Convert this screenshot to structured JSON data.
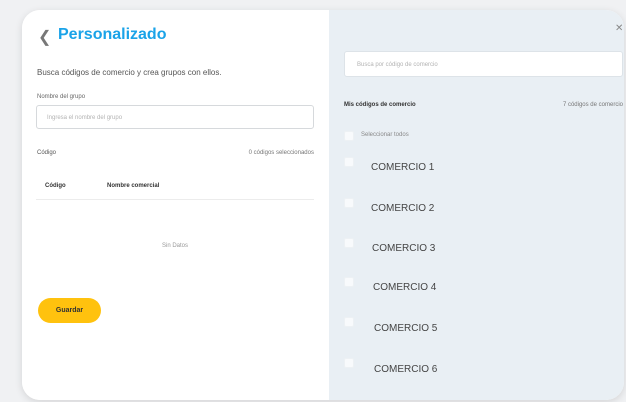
{
  "left": {
    "back_icon": "chevron-left",
    "title": "Personalizado",
    "description": "Busca códigos de comercio y crea grupos con ellos.",
    "group_name_label": "Nombre del grupo",
    "group_name_placeholder": "Ingresa el nombre del grupo",
    "code_label": "Código",
    "selected_count": "0 códigos seleccionados",
    "table": {
      "columns": [
        "Código",
        "Nombre comercial"
      ],
      "empty_text": "Sin Datos"
    },
    "save_label": "Guardar"
  },
  "right": {
    "close_icon": "close",
    "search_placeholder": "Busca por código de comercio",
    "my_codes_label": "Mis códigos de comercio",
    "codes_count": "7 códigos de comercio",
    "select_all_label": "Seleccionar todos",
    "items": [
      {
        "label": "COMERCIO 1"
      },
      {
        "label": "COMERCIO 2"
      },
      {
        "label": "COMERCIO 3"
      },
      {
        "label": "COMERCIO 4"
      },
      {
        "label": "COMERCIO 5"
      },
      {
        "label": "COMERCIO 6"
      }
    ]
  },
  "colors": {
    "accent": "#1aa3e8",
    "button": "#ffc20e",
    "panel": "#e9eff4"
  }
}
